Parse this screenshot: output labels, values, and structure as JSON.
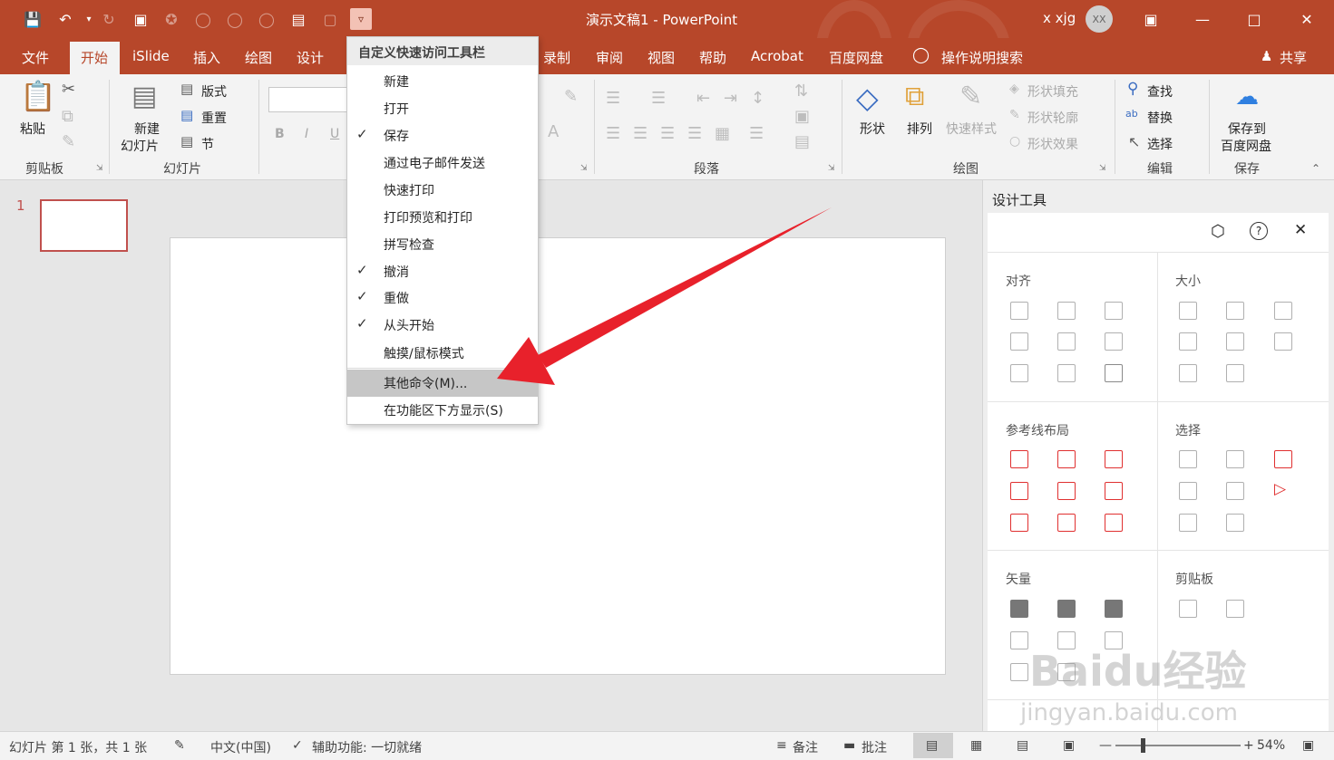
{
  "title_bar": {
    "doc_title": "演示文稿1 - PowerPoint",
    "user_name": "x xjg",
    "avatar_initials": "XX",
    "accent_color": "#b7472a"
  },
  "tabs": [
    "文件",
    "开始",
    "iSlide",
    "插入",
    "绘图",
    "设计",
    "录制",
    "审阅",
    "视图",
    "帮助",
    "Acrobat",
    "百度网盘"
  ],
  "active_tab": "开始",
  "tell_me": "操作说明搜索",
  "share": "共享",
  "ribbon": {
    "clipboard": {
      "paste": "粘贴",
      "group": "剪贴板"
    },
    "slides": {
      "new_line1": "新建",
      "new_line2": "幻灯片",
      "layout": "版式",
      "reset": "重置",
      "section": "节",
      "group": "幻灯片"
    },
    "font": {
      "bold": "B",
      "italic": "I",
      "underline": "U"
    },
    "paragraph": {
      "group": "段落"
    },
    "drawing": {
      "shapes": "形状",
      "arrange": "排列",
      "quick_styles": "快速样式",
      "fill": "形状填充",
      "outline": "形状轮廓",
      "effects": "形状效果",
      "group": "绘图"
    },
    "editing": {
      "find": "查找",
      "replace": "替换",
      "select": "选择",
      "group": "编辑"
    },
    "save": {
      "line1": "保存到",
      "line2": "百度网盘",
      "group": "保存"
    }
  },
  "thumbnail": {
    "number": "1"
  },
  "design_panel": {
    "title": "设计工具",
    "sections": {
      "align": "对齐",
      "size": "大小",
      "guides": "参考线布局",
      "select": "选择",
      "vector": "矢量",
      "clipboard": "剪贴板"
    }
  },
  "dropdown": {
    "header": "自定义快速访问工具栏",
    "items": [
      {
        "label": "新建",
        "checked": false
      },
      {
        "label": "打开",
        "checked": false
      },
      {
        "label": "保存",
        "checked": true
      },
      {
        "label": "通过电子邮件发送",
        "checked": false
      },
      {
        "label": "快速打印",
        "checked": false
      },
      {
        "label": "打印预览和打印",
        "checked": false
      },
      {
        "label": "拼写检查",
        "checked": false
      },
      {
        "label": "撤消",
        "checked": true
      },
      {
        "label": "重做",
        "checked": true
      },
      {
        "label": "从头开始",
        "checked": true
      },
      {
        "label": "触摸/鼠标模式",
        "checked": false
      }
    ],
    "more_commands": "其他命令(M)...",
    "show_below": "在功能区下方显示(S)"
  },
  "status_bar": {
    "slide_info": "幻灯片 第 1 张，共 1 张",
    "language": "中文(中国)",
    "accessibility": "辅助功能: 一切就绪",
    "notes": "备注",
    "comments": "批注",
    "zoom": "54%"
  },
  "arrow_color": "#e8212b",
  "watermark": {
    "brand": "Baidu经验",
    "url": "jingyan.baidu.com"
  }
}
